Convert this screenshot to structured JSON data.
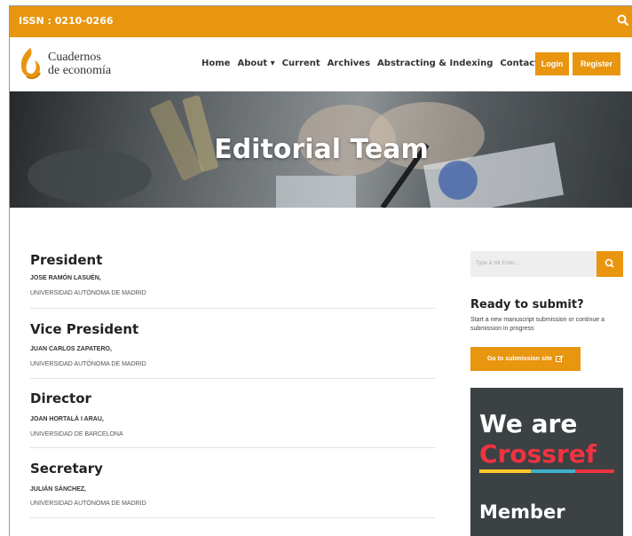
{
  "topbar": {
    "issn": "ISSN : 0210-0266"
  },
  "header": {
    "logo_line1": "Cuadernos",
    "logo_line2": "de economía",
    "nav": [
      "Home",
      "About ▾",
      "Current",
      "Archives",
      "Abstracting & Indexing",
      "Contact Us"
    ],
    "login_label": "Login",
    "register_label": "Register"
  },
  "hero": {
    "title": "Editorial Team"
  },
  "team": [
    {
      "role": "President",
      "name": "JOSE RAMÓN LASUÉN,",
      "affiliation": "UNIVERSIDAD AUTÓNOMA DE MADRID"
    },
    {
      "role": "Vice President",
      "name": "JUAN CARLOS ZAPATERO,",
      "affiliation": "UNIVERSIDAD AUTÓNOMA DE MADRID"
    },
    {
      "role": "Director",
      "name": "JOAN HORTALÀ I ARAU,",
      "affiliation": "UNIVERSIDAD DE BARCELONA"
    },
    {
      "role": "Secretary",
      "name": "JULIÁN SÁNCHEZ,",
      "affiliation": "UNIVERSIDAD AUTÓNOMA DE MADRID"
    }
  ],
  "sidebar": {
    "search_placeholder": "Type & Hit Enter...",
    "ready_title": "Ready to submit?",
    "ready_desc": "Start a new manuscript submission or continue a submission in progress",
    "submit_label": "Go to submission site",
    "crossref_line1": "We are",
    "crossref_line2": "Crossref",
    "crossref_member": "Member"
  },
  "colors": {
    "accent": "#e8950f",
    "crossref_bg": "#3c4144",
    "crossref_red": "#ef3340"
  },
  "icons": [
    "search-icon",
    "external-link-icon",
    "logo-flame-icon"
  ]
}
